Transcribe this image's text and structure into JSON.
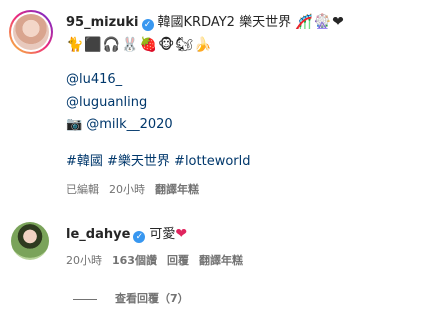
{
  "comment1": {
    "username": "95_mizuki",
    "text_line1": "韓國KRDAY2 樂天世界",
    "emojis_line1": "🎢🎡❤",
    "emojis_line2": "🐈⬛🎧🐰🍓🐵🐿🍌",
    "mention1": "@lu416_",
    "mention2": "@luguanling",
    "camera_icon": "camera-icon",
    "mention3": "@milk__2020",
    "hashtags": "#韓國 #樂天世界 #lotteworld",
    "meta": {
      "edited": "已編輯",
      "time": "20小時",
      "translate": "翻譯年糕"
    }
  },
  "comment2": {
    "username": "le_dahye",
    "text": "可愛",
    "heart": "❤",
    "meta": {
      "time": "20小時",
      "likes": "163個讚",
      "reply": "回覆",
      "translate": "翻譯年糕"
    }
  },
  "view_replies": "查看回覆（7）",
  "colors": {
    "verified": "#3897f0",
    "link": "#00376b",
    "meta": "#737373",
    "heart": "#e0245e"
  }
}
